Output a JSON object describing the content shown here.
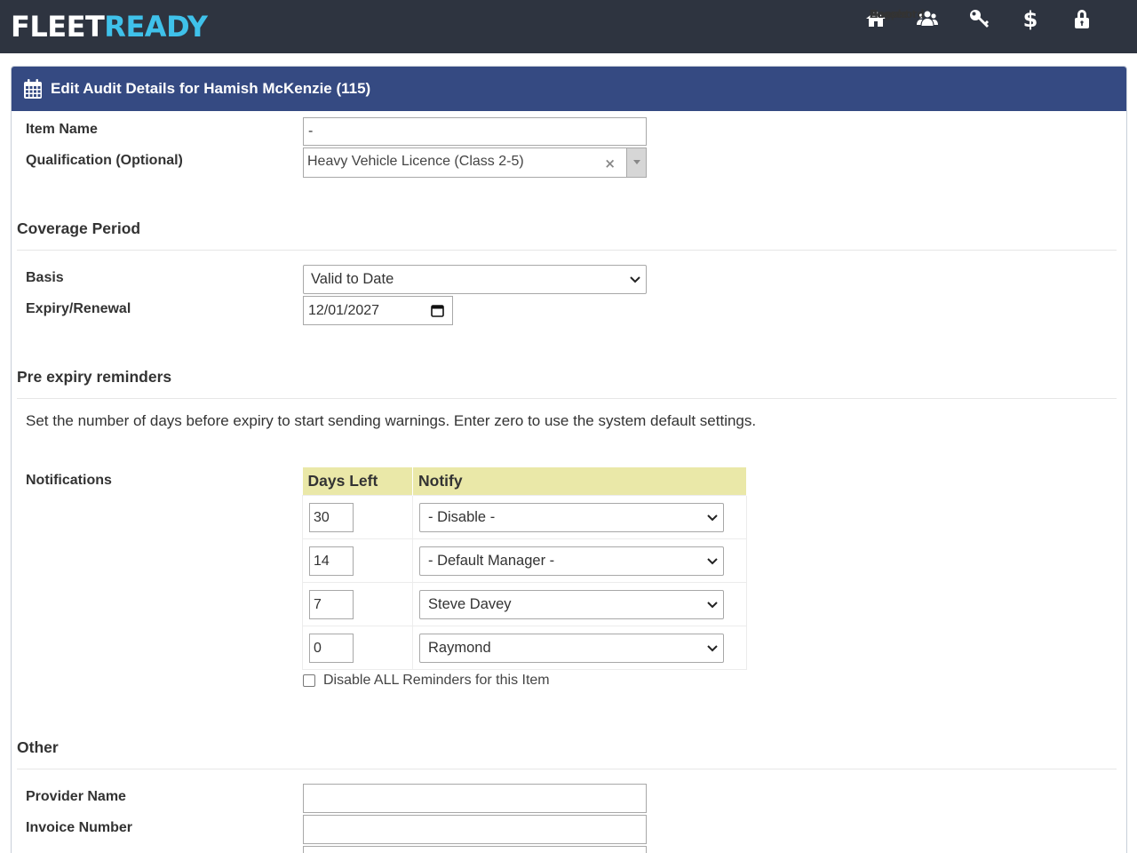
{
  "brand": {
    "part1": "FLEET",
    "part2": "READY"
  },
  "nav": [
    {
      "label": "Home",
      "icon": "home-icon"
    },
    {
      "label": "People",
      "icon": "people-icon"
    },
    {
      "label": "Password",
      "icon": "key-icon"
    },
    {
      "label": "Account",
      "icon": "dollar-icon"
    },
    {
      "label": "Logout",
      "icon": "lock-icon"
    }
  ],
  "panel": {
    "title": "Edit Audit Details for Hamish McKenzie (115)",
    "icon": "calendar-icon"
  },
  "fields": {
    "item_name_label": "Item Name",
    "item_name_value": "-",
    "qualification_label": "Qualification (Optional)",
    "qualification_value": "Heavy Vehicle Licence (Class 2-5)",
    "qualification_clear": "×"
  },
  "coverage": {
    "heading": "Coverage Period",
    "basis_label": "Basis",
    "basis_value": "Valid to Date",
    "expiry_label": "Expiry/Renewal",
    "expiry_value": "12/01/2027"
  },
  "reminders": {
    "heading": "Pre expiry reminders",
    "description": "Set the number of days before expiry to start sending warnings. Enter zero to use the system default settings.",
    "notifications_label": "Notifications",
    "col_days": "Days Left",
    "col_notify": "Notify",
    "rows": [
      {
        "days": "30",
        "notify": "- Disable -"
      },
      {
        "days": "14",
        "notify": "- Default Manager -"
      },
      {
        "days": "7",
        "notify": "Steve Davey"
      },
      {
        "days": "0",
        "notify": "Raymond"
      }
    ],
    "disable_all_label": "Disable ALL Reminders for this Item"
  },
  "other": {
    "heading": "Other",
    "provider_label": "Provider Name",
    "provider_value": "",
    "invoice_label": "Invoice Number",
    "invoice_value": ""
  },
  "colors": {
    "topbar": "#2e3440",
    "brand_accent": "#3fc1ea",
    "panel_header": "#354a82",
    "table_header": "#eae8a8"
  }
}
